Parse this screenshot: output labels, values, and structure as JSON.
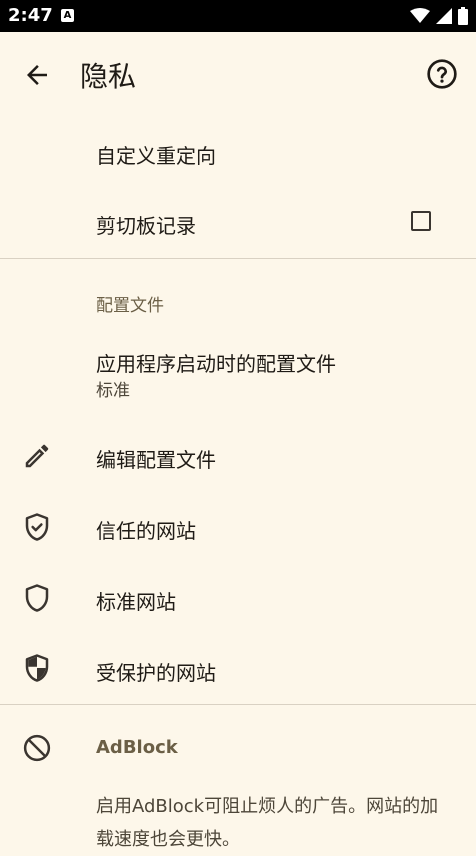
{
  "status": {
    "time": "2:47",
    "notification_icon": "A"
  },
  "header": {
    "title": "隐私"
  },
  "items": {
    "custom_redirect": "自定义重定向",
    "clipboard_history": "剪切板记录",
    "clipboard_checked": false,
    "profile_section": "配置文件",
    "startup_profile": "应用程序启动时的配置文件",
    "startup_profile_value": "标准",
    "edit_profile": "编辑配置文件",
    "trusted_sites": "信任的网站",
    "standard_sites": "标准网站",
    "protected_sites": "受保护的网站",
    "adblock_title": "AdBlock",
    "adblock_desc": "启用AdBlock可阻止烦人的广告。网站的加载速度也会更快。"
  }
}
